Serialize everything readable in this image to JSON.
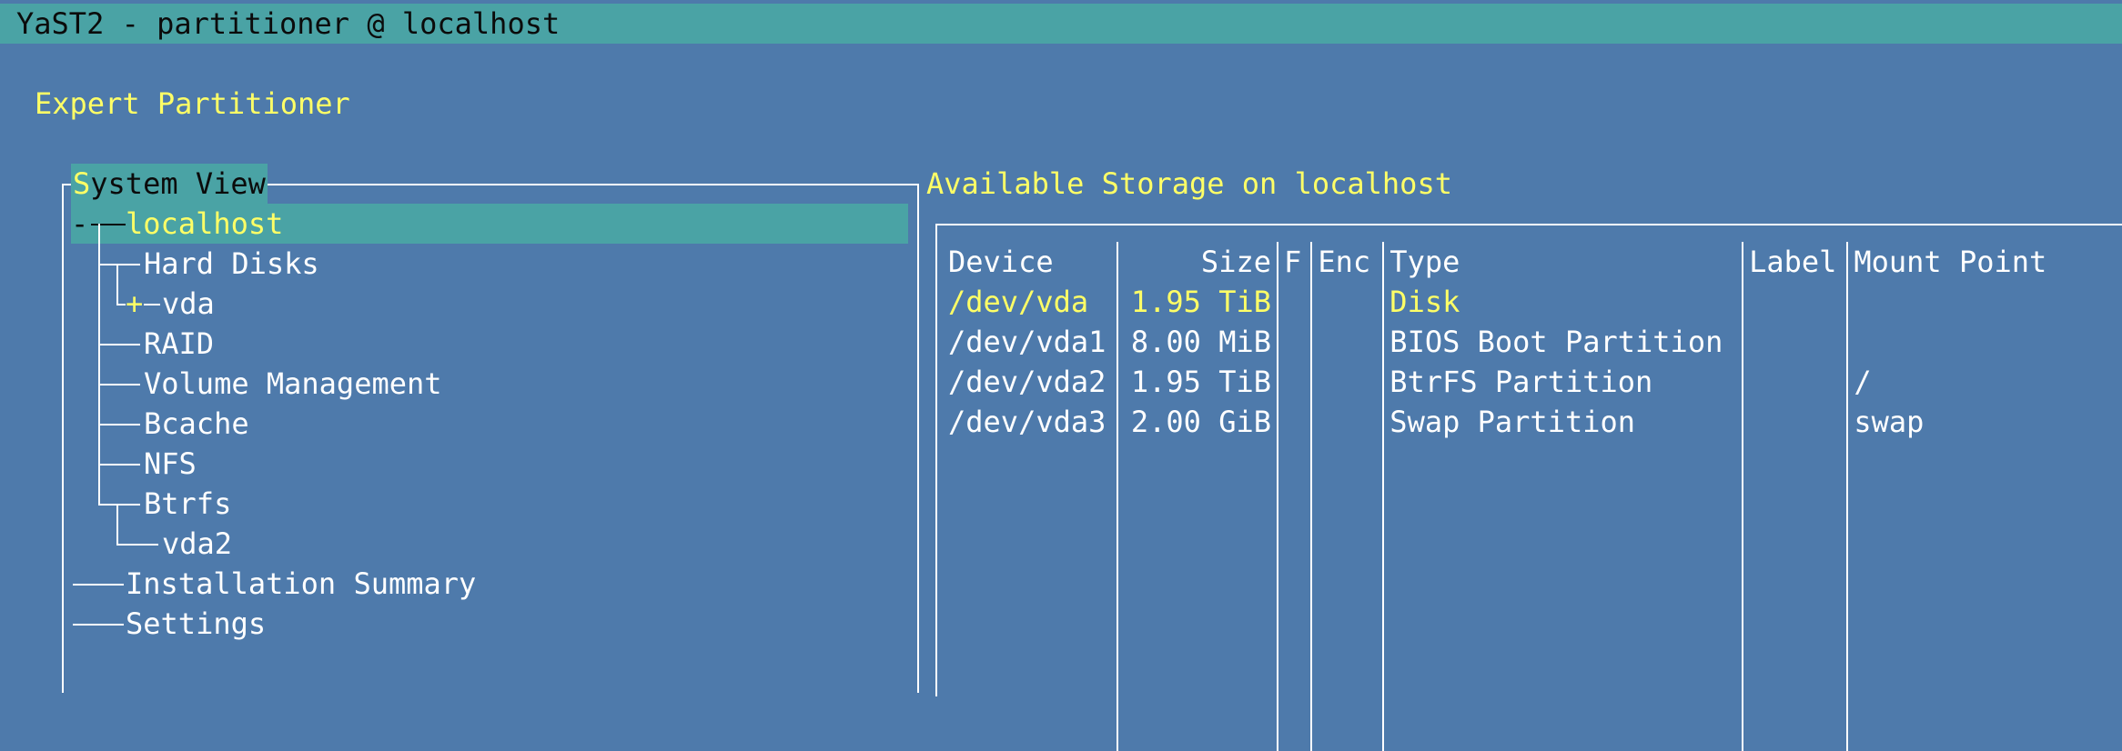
{
  "window": {
    "title": "YaST2 - partitioner @ localhost"
  },
  "heading": "Expert Partitioner",
  "system_view": {
    "title": "System View",
    "hotkey": "S",
    "title_rest": "ystem View",
    "root_prefix": "-",
    "expander": "+",
    "items": {
      "localhost": "localhost",
      "hard_disks": "Hard Disks",
      "vda": "vda",
      "raid": "RAID",
      "volume_management": "Volume Management",
      "bcache": "Bcache",
      "nfs": "NFS",
      "btrfs": "Btrfs",
      "vda2": "vda2",
      "installation_summary": "Installation Summary",
      "settings": "Settings"
    }
  },
  "storage": {
    "title": "Available Storage on localhost",
    "columns": [
      "Device",
      "Size",
      "F",
      "Enc",
      "Type",
      "Label",
      "Mount Point"
    ],
    "rows": [
      {
        "device": "/dev/vda",
        "size": "1.95 TiB",
        "f": "",
        "enc": "",
        "type": "Disk",
        "label": "",
        "mount": ""
      },
      {
        "device": "/dev/vda1",
        "size": "8.00 MiB",
        "f": "",
        "enc": "",
        "type": "BIOS Boot Partition",
        "label": "",
        "mount": ""
      },
      {
        "device": "/dev/vda2",
        "size": "1.95 TiB",
        "f": "",
        "enc": "",
        "type": "BtrFS Partition",
        "label": "",
        "mount": "/"
      },
      {
        "device": "/dev/vda3",
        "size": "2.00 GiB",
        "f": "",
        "enc": "",
        "type": "Swap Partition",
        "label": "",
        "mount": "swap"
      }
    ]
  },
  "colors": {
    "background": "#4e7aab",
    "highlight": "#4aa3a5",
    "accent_text": "#ffff66",
    "text": "#ffffff",
    "title_text": "#0b0b0b"
  }
}
